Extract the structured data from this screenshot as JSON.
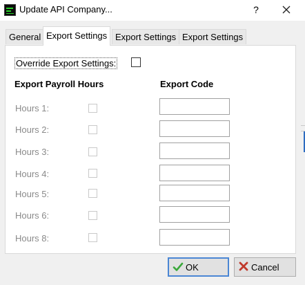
{
  "window": {
    "title": "Update API Company...",
    "help_glyph": "?"
  },
  "tabs": [
    {
      "label": "General",
      "active": false
    },
    {
      "label": "Export Settings",
      "active": true
    },
    {
      "label": "Export Settings",
      "active": false
    },
    {
      "label": "Export Settings",
      "active": false
    }
  ],
  "override": {
    "label": "Override Export Settings:",
    "checked": false
  },
  "headers": {
    "hours": "Export Payroll Hours",
    "code": "Export Code"
  },
  "rows": [
    {
      "label": "Hours 1:",
      "checked": false,
      "code": ""
    },
    {
      "label": "Hours 2:",
      "checked": false,
      "code": ""
    },
    {
      "label": "Hours 3:",
      "checked": false,
      "code": ""
    },
    {
      "label": "Hours 4:",
      "checked": false,
      "code": ""
    },
    {
      "label": "Hours 5:",
      "checked": false,
      "code": ""
    },
    {
      "label": "Hours 6:",
      "checked": false,
      "code": ""
    },
    {
      "label": "Hours 8:",
      "checked": false,
      "code": ""
    }
  ],
  "buttons": {
    "ok": "OK",
    "cancel": "Cancel"
  },
  "colors": {
    "ok_check": "#3aa83a",
    "cancel_x": "#c0392b",
    "accent_border": "#4a86d4"
  }
}
